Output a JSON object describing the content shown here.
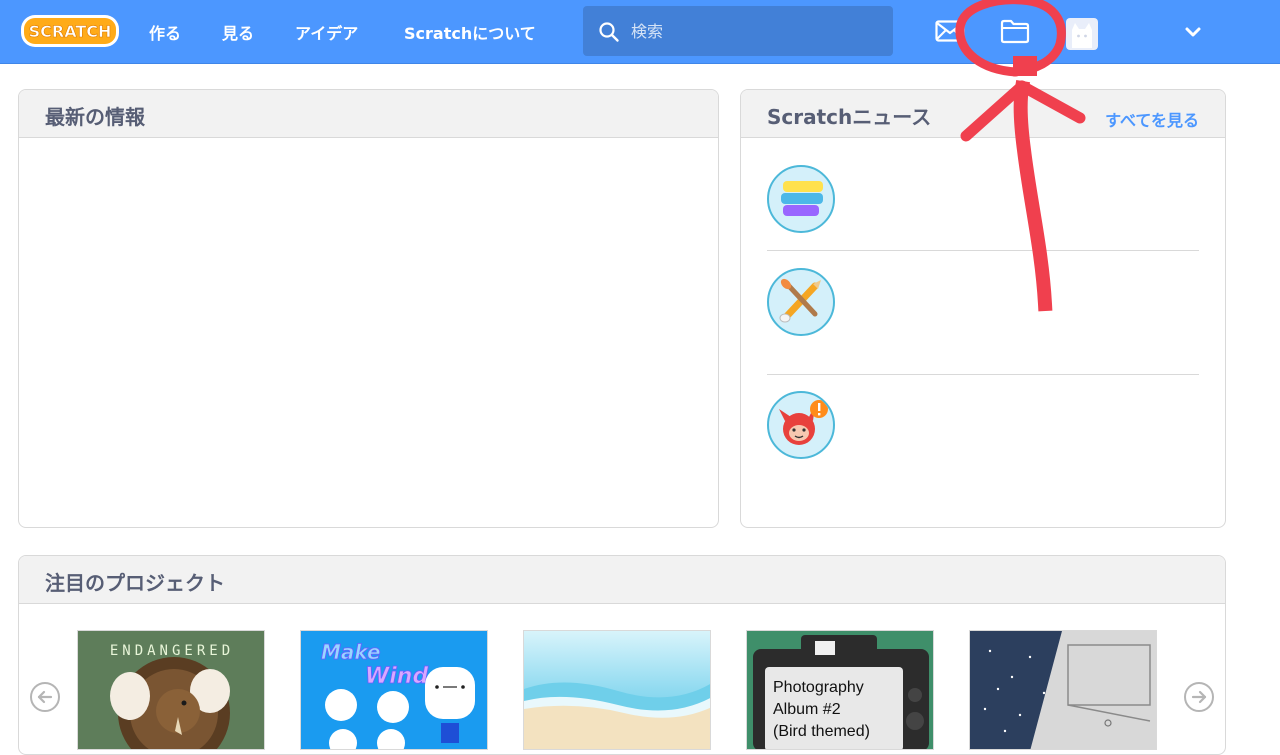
{
  "header": {
    "logo_text": "SCRATCH",
    "nav": [
      {
        "label": "作る"
      },
      {
        "label": "見る"
      },
      {
        "label": "アイデア"
      },
      {
        "label": "Scratchについて"
      }
    ],
    "search": {
      "placeholder": "検索",
      "value": ""
    },
    "icons": [
      "search-icon",
      "messages-icon",
      "my-stuff-folder-icon",
      "avatar",
      "chevron-down-icon"
    ],
    "colors": {
      "bar": "#4c97ff",
      "search": "#4280d7"
    }
  },
  "whats_happening": {
    "title": "最新の情報"
  },
  "news": {
    "title": "Scratchニュース",
    "see_all": "すべてを見る",
    "items": [
      {
        "icon": "colored-blocks-icon"
      },
      {
        "icon": "paintbrush-pencil-icon"
      },
      {
        "icon": "red-mascot-alert-icon"
      }
    ]
  },
  "featured": {
    "title": "注目のプロジェクト",
    "projects": [
      {
        "thumb_text": "ENDANGERED"
      },
      {
        "thumb_text_1": "Make",
        "thumb_text_2": "Wind"
      },
      {
        "thumb_text": ""
      },
      {
        "thumb_text_1": "Photography",
        "thumb_text_2": "Album #2",
        "thumb_text_3": "(Bird themed)"
      },
      {
        "thumb_text": ""
      }
    ]
  },
  "annotation": {
    "color": "#f0404e",
    "marks": [
      "red-circle-highlight",
      "red-arrow-pointer"
    ]
  }
}
